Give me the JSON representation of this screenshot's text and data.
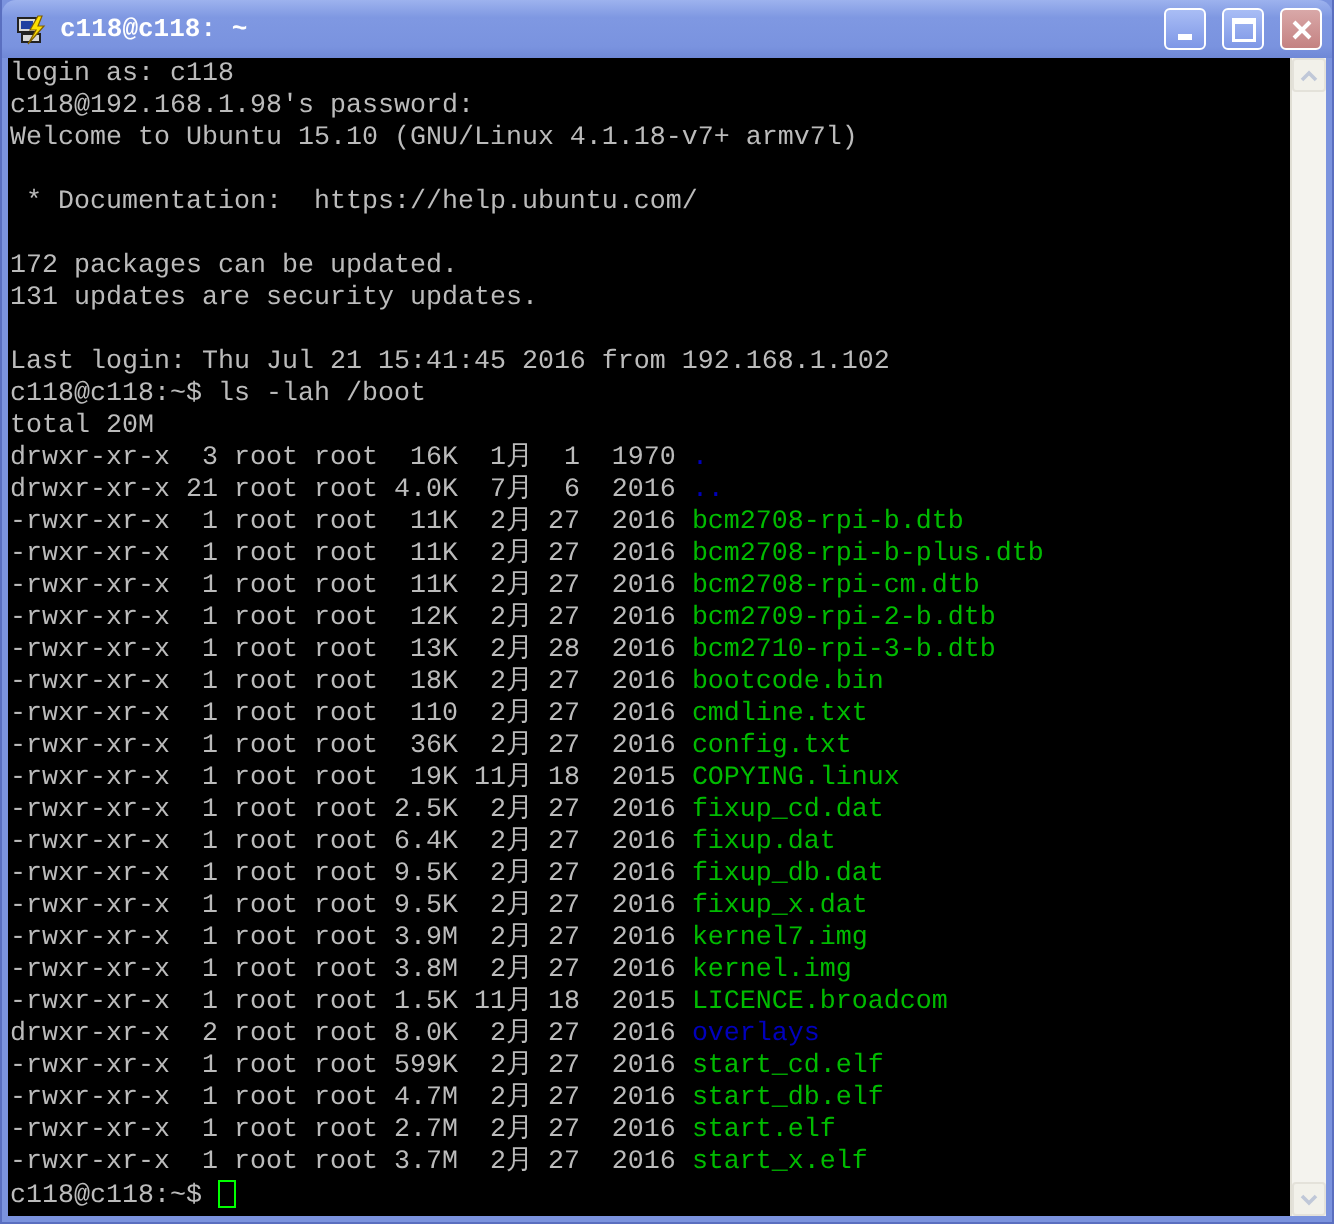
{
  "window": {
    "title": "c118@c118: ~"
  },
  "terminal": {
    "lines": [
      {
        "kind": "text",
        "text": "login as: c118"
      },
      {
        "kind": "text",
        "text": "c118@192.168.1.98's password:"
      },
      {
        "kind": "text",
        "text": "Welcome to Ubuntu 15.10 (GNU/Linux 4.1.18-v7+ armv7l)"
      },
      {
        "kind": "blank"
      },
      {
        "kind": "text",
        "text": " * Documentation:  https://help.ubuntu.com/"
      },
      {
        "kind": "blank"
      },
      {
        "kind": "text",
        "text": "172 packages can be updated."
      },
      {
        "kind": "text",
        "text": "131 updates are security updates."
      },
      {
        "kind": "blank"
      },
      {
        "kind": "text",
        "text": "Last login: Thu Jul 21 15:41:45 2016 from 192.168.1.102"
      },
      {
        "kind": "text",
        "text": "c118@c118:~$ ls -lah /boot"
      },
      {
        "kind": "text",
        "text": "total 20M"
      },
      {
        "kind": "listing",
        "text": "drwxr-xr-x  3 root root  16K  1月  1  1970 ",
        "file": ".",
        "color": "#0000bb"
      },
      {
        "kind": "listing",
        "text": "drwxr-xr-x 21 root root 4.0K  7月  6  2016 ",
        "file": "..",
        "color": "#0000bb"
      },
      {
        "kind": "listing",
        "text": "-rwxr-xr-x  1 root root  11K  2月 27  2016 ",
        "file": "bcm2708-rpi-b.dtb",
        "color": "#00bb00"
      },
      {
        "kind": "listing",
        "text": "-rwxr-xr-x  1 root root  11K  2月 27  2016 ",
        "file": "bcm2708-rpi-b-plus.dtb",
        "color": "#00bb00"
      },
      {
        "kind": "listing",
        "text": "-rwxr-xr-x  1 root root  11K  2月 27  2016 ",
        "file": "bcm2708-rpi-cm.dtb",
        "color": "#00bb00"
      },
      {
        "kind": "listing",
        "text": "-rwxr-xr-x  1 root root  12K  2月 27  2016 ",
        "file": "bcm2709-rpi-2-b.dtb",
        "color": "#00bb00"
      },
      {
        "kind": "listing",
        "text": "-rwxr-xr-x  1 root root  13K  2月 28  2016 ",
        "file": "bcm2710-rpi-3-b.dtb",
        "color": "#00bb00"
      },
      {
        "kind": "listing",
        "text": "-rwxr-xr-x  1 root root  18K  2月 27  2016 ",
        "file": "bootcode.bin",
        "color": "#00bb00"
      },
      {
        "kind": "listing",
        "text": "-rwxr-xr-x  1 root root  110  2月 27  2016 ",
        "file": "cmdline.txt",
        "color": "#00bb00"
      },
      {
        "kind": "listing",
        "text": "-rwxr-xr-x  1 root root  36K  2月 27  2016 ",
        "file": "config.txt",
        "color": "#00bb00"
      },
      {
        "kind": "listing",
        "text": "-rwxr-xr-x  1 root root  19K 11月 18  2015 ",
        "file": "COPYING.linux",
        "color": "#00bb00"
      },
      {
        "kind": "listing",
        "text": "-rwxr-xr-x  1 root root 2.5K  2月 27  2016 ",
        "file": "fixup_cd.dat",
        "color": "#00bb00"
      },
      {
        "kind": "listing",
        "text": "-rwxr-xr-x  1 root root 6.4K  2月 27  2016 ",
        "file": "fixup.dat",
        "color": "#00bb00"
      },
      {
        "kind": "listing",
        "text": "-rwxr-xr-x  1 root root 9.5K  2月 27  2016 ",
        "file": "fixup_db.dat",
        "color": "#00bb00"
      },
      {
        "kind": "listing",
        "text": "-rwxr-xr-x  1 root root 9.5K  2月 27  2016 ",
        "file": "fixup_x.dat",
        "color": "#00bb00"
      },
      {
        "kind": "listing",
        "text": "-rwxr-xr-x  1 root root 3.9M  2月 27  2016 ",
        "file": "kernel7.img",
        "color": "#00bb00"
      },
      {
        "kind": "listing",
        "text": "-rwxr-xr-x  1 root root 3.8M  2月 27  2016 ",
        "file": "kernel.img",
        "color": "#00bb00"
      },
      {
        "kind": "listing",
        "text": "-rwxr-xr-x  1 root root 1.5K 11月 18  2015 ",
        "file": "LICENCE.broadcom",
        "color": "#00bb00"
      },
      {
        "kind": "listing",
        "text": "drwxr-xr-x  2 root root 8.0K  2月 27  2016 ",
        "file": "overlays",
        "color": "#0000bb"
      },
      {
        "kind": "listing",
        "text": "-rwxr-xr-x  1 root root 599K  2月 27  2016 ",
        "file": "start_cd.elf",
        "color": "#00bb00"
      },
      {
        "kind": "listing",
        "text": "-rwxr-xr-x  1 root root 4.7M  2月 27  2016 ",
        "file": "start_db.elf",
        "color": "#00bb00"
      },
      {
        "kind": "listing",
        "text": "-rwxr-xr-x  1 root root 2.7M  2月 27  2016 ",
        "file": "start.elf",
        "color": "#00bb00"
      },
      {
        "kind": "listing",
        "text": "-rwxr-xr-x  1 root root 3.7M  2月 27  2016 ",
        "file": "start_x.elf",
        "color": "#00bb00"
      },
      {
        "kind": "prompt",
        "text": "c118@c118:~$ ",
        "cursor": true
      }
    ]
  }
}
